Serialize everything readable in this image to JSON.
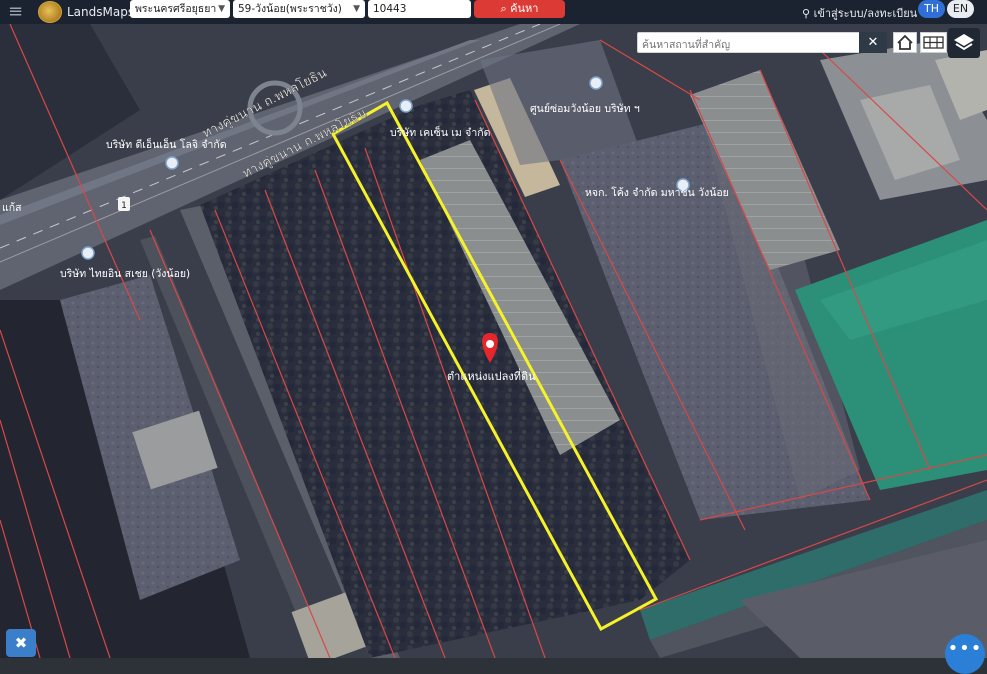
{
  "header": {
    "brand": "LandsMaps",
    "province": "พระนครศรีอยุธยา",
    "district": "59-วังน้อย(พระราชวัง)",
    "parcel_no": "10443",
    "search_label": "ค้นหา",
    "login_label": "เข้าสู่ระบบ/ลงทะเบียน",
    "lang_th": "TH",
    "lang_en": "EN"
  },
  "map": {
    "search_placeholder": "ค้นหาสถานที่สำคัญ",
    "clear_label": "✕",
    "marker_label": "ตำแหน่งแปลงที่ดิน",
    "road_labels": [
      "ทางคู่ขนาน ถ.พหลโยธิน",
      "ทางคู่ขนาน ถ.พหลโยธิน"
    ],
    "route_shield": "1",
    "places": [
      "บริษัท เคเซ็น เม จำกัด",
      "ศูนย์ซ่อมวังน้อย บริษัท ฯ",
      "หจก. โค้ง จำกัด มหาชน วังน้อย",
      "บริษัท ไทยอิน สเชย (วังน้อย)",
      "บริษัท ดีเอ็นเอ็น โลจิ จำกัด",
      "แก้ส"
    ]
  },
  "colors": {
    "topbar": "#1b2330",
    "search_button": "#dc3b35",
    "parcel_outline": "#f6f22a",
    "marker": "#e5262d",
    "boundary": "#d84848",
    "lang_active": "#2f6fd6"
  }
}
